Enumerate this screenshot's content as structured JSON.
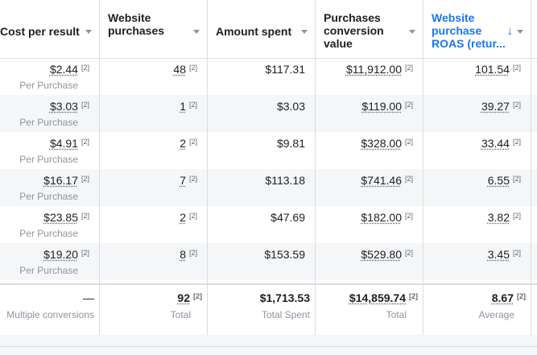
{
  "columns": [
    {
      "label": "Cost per result",
      "sorted": false
    },
    {
      "label": "Website purchases",
      "sorted": false
    },
    {
      "label": "Amount spent",
      "sorted": false
    },
    {
      "label": "Purchases conversion value",
      "sorted": false
    },
    {
      "label": "Website purchase ROAS (retur...",
      "sorted": true,
      "sort_direction": "descending"
    }
  ],
  "colors": {
    "accent": "#1877f2",
    "border": "#dadde1",
    "alt_row": "#f5f6f7",
    "muted": "#8d949e"
  },
  "footnote_marker": "[2]",
  "rows": [
    {
      "cost": "$2.44",
      "cost_sub": "Per Purchase",
      "purchases": "48",
      "spent": "$117.31",
      "value": "$11,912.00",
      "roas": "101.54"
    },
    {
      "cost": "$3.03",
      "cost_sub": "Per Purchase",
      "purchases": "1",
      "spent": "$3.03",
      "value": "$119.00",
      "roas": "39.27"
    },
    {
      "cost": "$4.91",
      "cost_sub": "Per Purchase",
      "purchases": "2",
      "spent": "$9.81",
      "value": "$328.00",
      "roas": "33.44"
    },
    {
      "cost": "$16.17",
      "cost_sub": "Per Purchase",
      "purchases": "7",
      "spent": "$113.18",
      "value": "$741.46",
      "roas": "6.55"
    },
    {
      "cost": "$23.85",
      "cost_sub": "Per Purchase",
      "purchases": "2",
      "spent": "$47.69",
      "value": "$182.00",
      "roas": "3.82"
    },
    {
      "cost": "$19.20",
      "cost_sub": "Per Purchase",
      "purchases": "8",
      "spent": "$153.59",
      "value": "$529.80",
      "roas": "3.45"
    }
  ],
  "totals": {
    "cost": "—",
    "cost_sub": "Multiple conversions",
    "purchases": "92",
    "purchases_sub": "Total",
    "spent": "$1,713.53",
    "spent_sub": "Total Spent",
    "value": "$14,859.74",
    "value_sub": "Total",
    "roas": "8.67",
    "roas_sub": "Average"
  }
}
